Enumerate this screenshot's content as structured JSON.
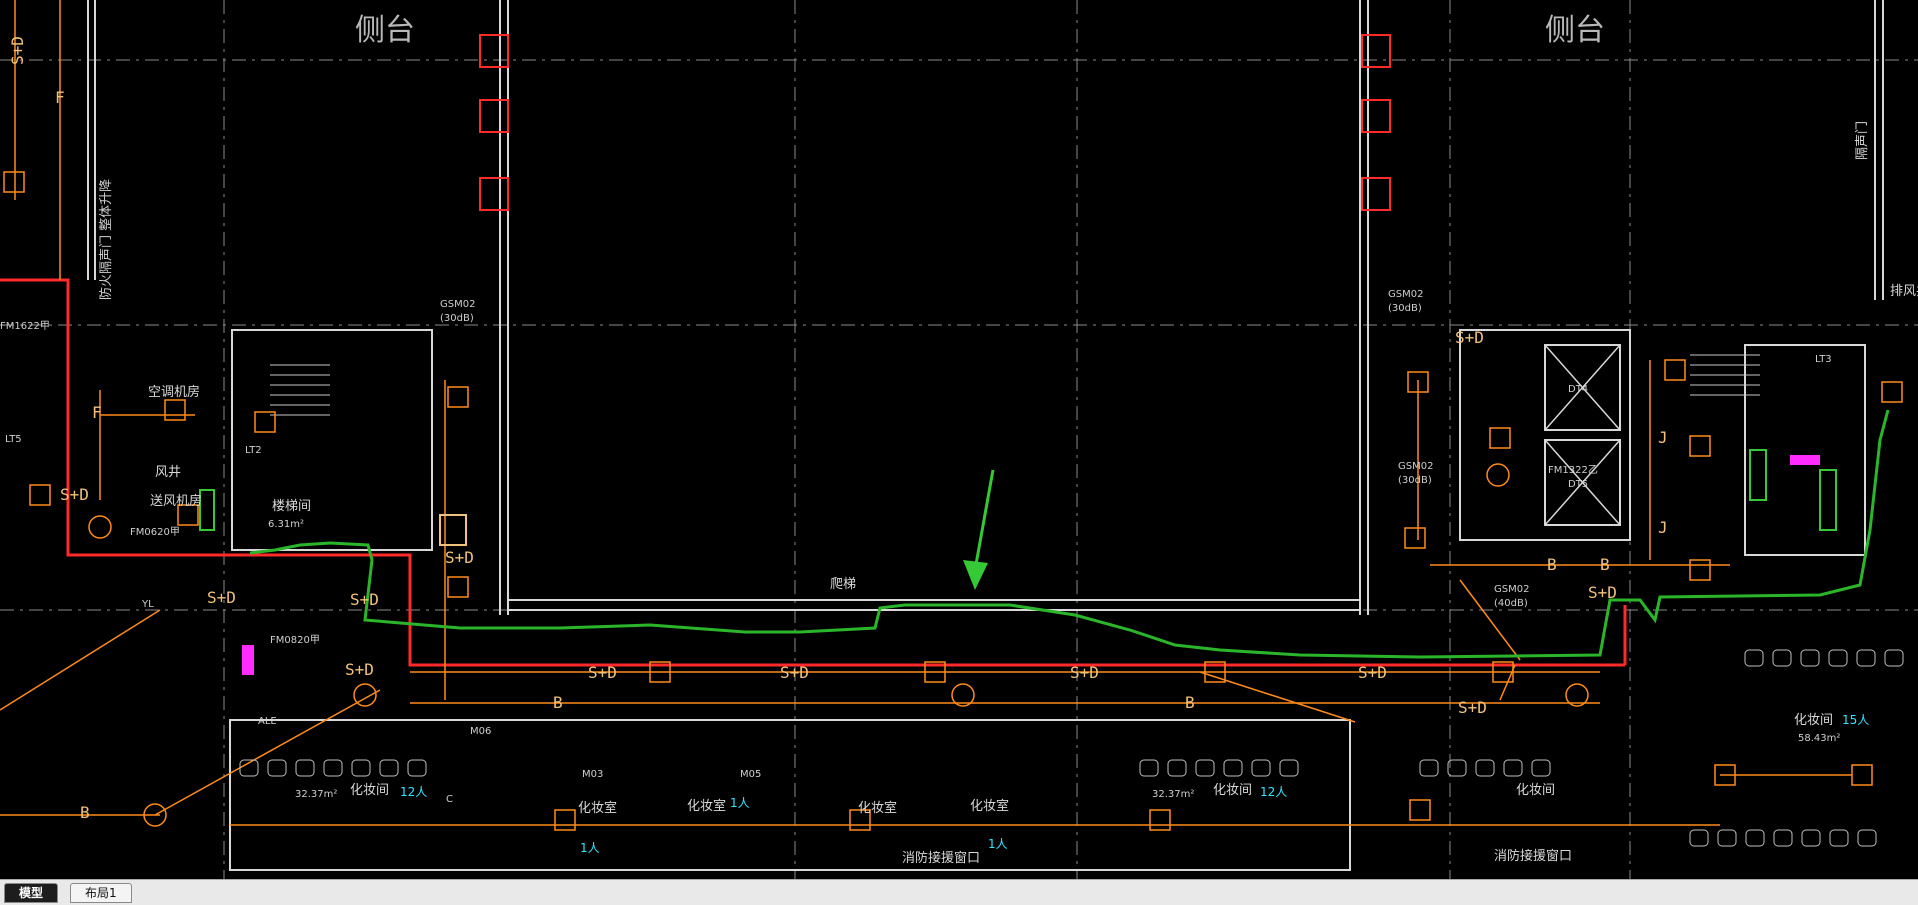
{
  "drawing": {
    "stage_labels": [
      "侧台",
      "侧台"
    ],
    "gsm_labels": [
      "GSM02",
      "GSM02",
      "GSM02",
      "GSM02"
    ],
    "db_labels": [
      "(30dB)",
      "(30dB)",
      "(40dB)",
      "(30dB)"
    ],
    "room_labels": [
      {
        "text": "空调机房"
      },
      {
        "text": "风井"
      },
      {
        "text": "送风机房"
      },
      {
        "text": "楼梯间"
      },
      {
        "text": "爬梯"
      },
      {
        "text": "化妆间"
      },
      {
        "text": "化妆间"
      },
      {
        "text": "化妆间"
      },
      {
        "text": "化妆间"
      },
      {
        "text": "化妆室"
      },
      {
        "text": "化妆室"
      },
      {
        "text": "化妆室"
      },
      {
        "text": "化妆室"
      },
      {
        "text": "消防接援窗口"
      },
      {
        "text": "消防接援窗口"
      },
      {
        "text": "隔声门"
      },
      {
        "text": "排风井"
      }
    ],
    "equipment_tags": [
      "S+D",
      "S+D",
      "S+D",
      "S+D",
      "S+D",
      "S+D",
      "S+D",
      "S+D",
      "S+D",
      "S+D",
      "S+D",
      "S+D",
      "S+D"
    ],
    "line_tags": [
      "B",
      "B",
      "B",
      "B",
      "B",
      "F",
      "F",
      "J",
      "J"
    ],
    "code_labels": [
      "FM1622甲",
      "FM0620甲",
      "FM0820甲",
      "FM1322乙",
      "LT2",
      "LT3",
      "LT5",
      "DT4",
      "DT5",
      "YL",
      "ALE",
      "M06",
      "M03",
      "M05",
      "C"
    ],
    "area_labels": [
      "32.37m²",
      "32.37m²",
      "58.43m²",
      "6.31m²"
    ],
    "occupancy_labels": [
      "12人",
      "12人",
      "15人",
      "1人",
      "1人",
      "1人"
    ],
    "vertical_text": [
      "防火隔声门 整体升降"
    ]
  },
  "tabs": {
    "model": "模型",
    "layout1": "布局1"
  },
  "colors": {
    "background": "#000000",
    "wall": "#d8d8d8",
    "cable": "#ff8c1a",
    "route_highlight": "#2bb52b",
    "arrow": "#35c935",
    "fire_zone": "#ff2a2a",
    "grid": "#8a8a8a",
    "magenta": "#ff2bff",
    "cyan": "#2ee6ff"
  }
}
